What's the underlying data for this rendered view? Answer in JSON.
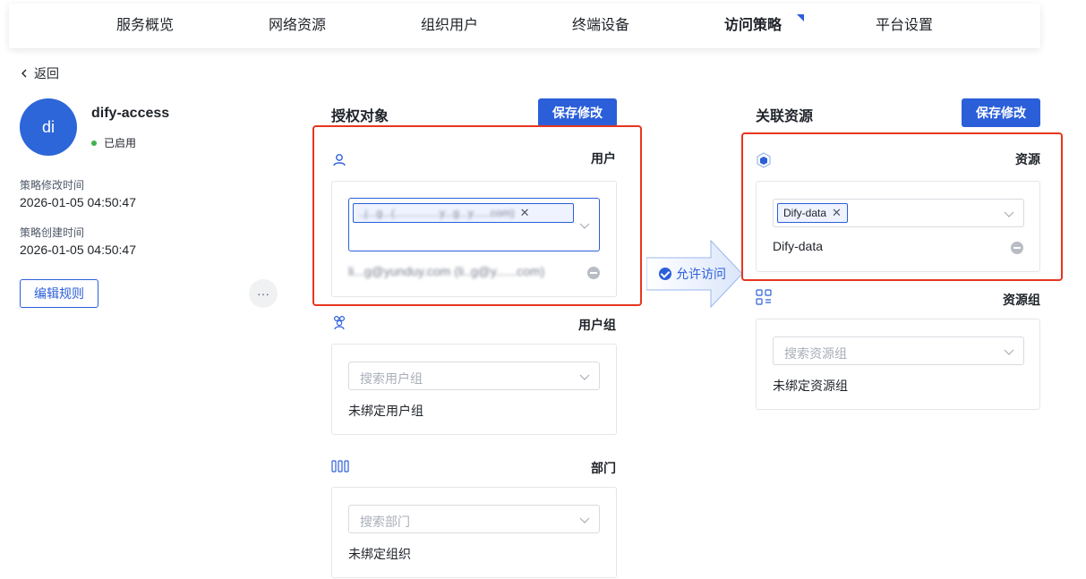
{
  "nav": {
    "items": [
      "服务概览",
      "网络资源",
      "组织用户",
      "终端设备",
      "访问策略",
      "平台设置"
    ],
    "active_index": 4
  },
  "back_label": "返回",
  "policy": {
    "avatar_text": "di",
    "name": "dify-access",
    "status": "已启用",
    "modified_label": "策略修改时间",
    "modified_value": "2026-01-05 04:50:47",
    "created_label": "策略创建时间",
    "created_value": "2026-01-05 04:50:47",
    "edit_rules_label": "编辑规则",
    "more_label": "···"
  },
  "authorized": {
    "title": "授权对象",
    "save_label": "保存修改",
    "user": {
      "label": "用户",
      "selected_tag": "..j...g...(...............y...g...y......com)",
      "listed_item": "li...g@yunduy.com (li..g@y......com)"
    },
    "user_group": {
      "label": "用户组",
      "placeholder": "搜索用户组",
      "empty": "未绑定用户组"
    },
    "department": {
      "label": "部门",
      "placeholder": "搜索部门",
      "empty": "未绑定组织"
    }
  },
  "connector": {
    "label": "允许访问"
  },
  "resources": {
    "title": "关联资源",
    "save_label": "保存修改",
    "resource": {
      "label": "资源",
      "selected_tag": "Dify-data",
      "listed_item": "Dify-data"
    },
    "resource_group": {
      "label": "资源组",
      "placeholder": "搜索资源组",
      "empty": "未绑定资源组"
    }
  },
  "colors": {
    "primary": "#2b5fd9",
    "highlight_frame": "#e8351e",
    "status_dot": "#3fb24c"
  }
}
